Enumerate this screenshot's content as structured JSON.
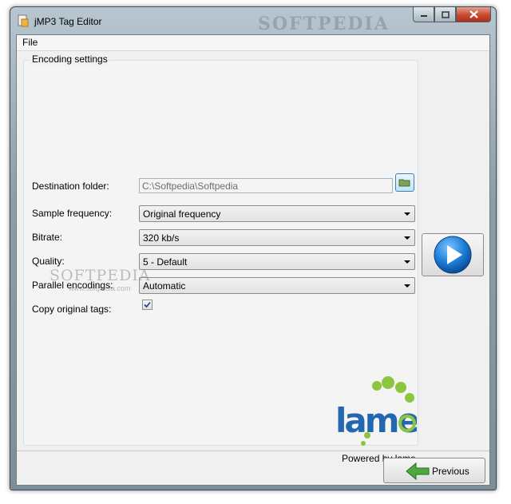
{
  "window": {
    "title": "jMP3 Tag Editor",
    "watermark": "SOFTPEDIA"
  },
  "menu": {
    "file": "File"
  },
  "group": {
    "legend": "Encoding settings"
  },
  "fields": {
    "destination_label": "Destination folder:",
    "destination_value": "C:\\Softpedia\\Softpedia",
    "sample_label": "Sample frequency:",
    "sample_value": "Original frequency",
    "bitrate_label": "Bitrate:",
    "bitrate_value": "320 kb/s",
    "quality_label": "Quality:",
    "quality_value": "5 - Default",
    "parallel_label": "Parallel encodings:",
    "parallel_value": "Automatic",
    "copy_label": "Copy original tags:",
    "copy_checked": true
  },
  "watermark_mid": {
    "main": "SOFTPEDIA",
    "sub": "www.softpedia.com"
  },
  "logo": {
    "text": "lame",
    "powered": "Powered by lame"
  },
  "buttons": {
    "previous": "Previous"
  },
  "colors": {
    "accent": "#1d7fd6",
    "lame_blue": "#2367b0",
    "lame_green": "#8cc63f"
  },
  "icons": [
    "app-icon",
    "minimize-icon",
    "maximize-icon",
    "close-icon",
    "folder-icon",
    "play-icon",
    "back-arrow-icon",
    "checkmark-icon"
  ]
}
